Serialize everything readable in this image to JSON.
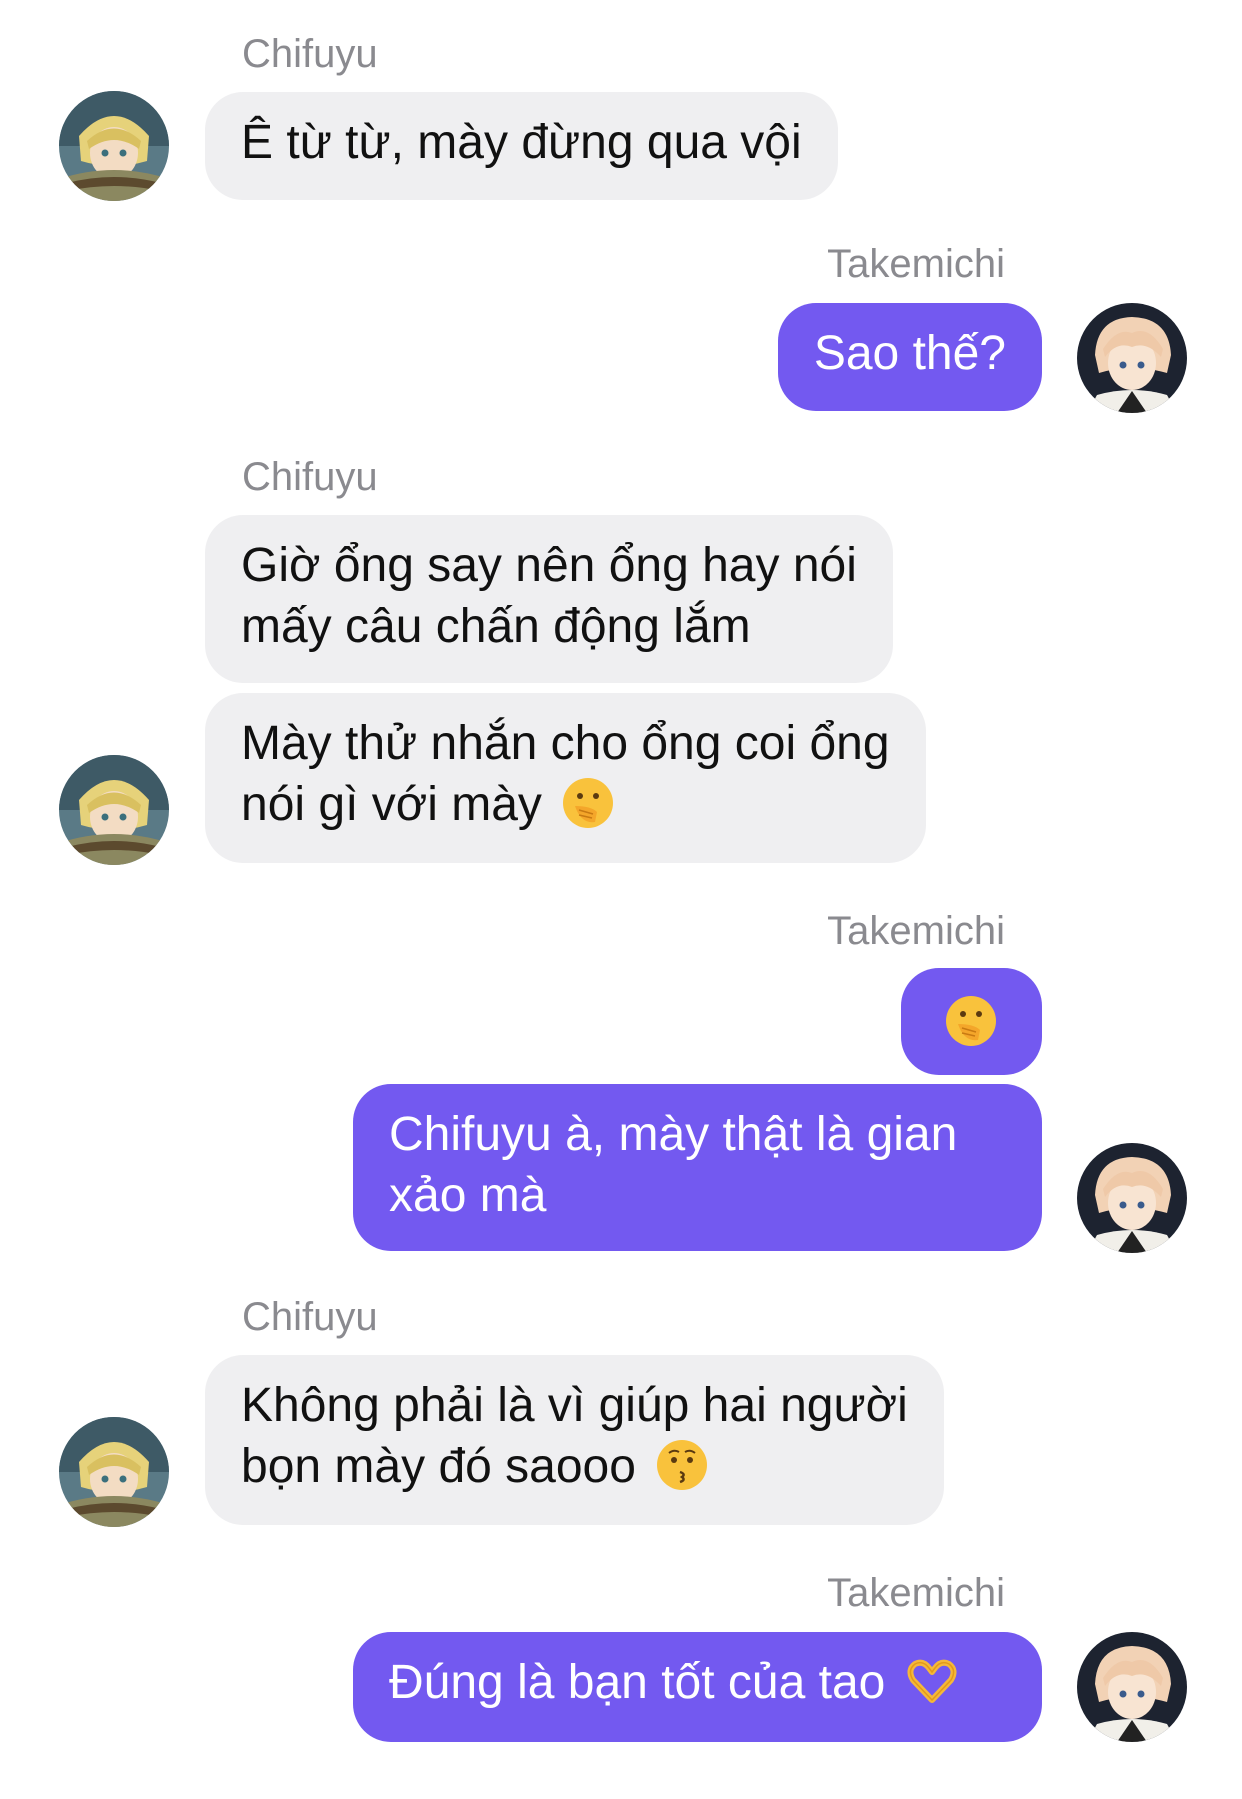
{
  "participants": {
    "friend": "Chifuyu",
    "me": "Takemichi"
  },
  "messages": [
    {
      "sender": "Chifuyu",
      "lines": [
        "Ê từ từ, mày đừng qua vội"
      ]
    },
    {
      "sender": "Takemichi",
      "lines": [
        "Sao thế?"
      ]
    },
    {
      "sender": "Chifuyu",
      "lines": [
        "Giờ ổng say nên ổng hay nói",
        "mấy câu chấn động lắm"
      ]
    },
    {
      "sender": "Chifuyu",
      "lines": [
        "Mày thử nhắn cho ổng coi ổng",
        "nói gì với mày"
      ],
      "emoji": "face-with-hand-over-mouth-emoji"
    },
    {
      "sender": "Takemichi",
      "lines": [
        ""
      ],
      "emoji": "face-with-hand-over-mouth-emoji"
    },
    {
      "sender": "Takemichi",
      "lines": [
        "Chifuyu à, mày thật là gian",
        "xảo mà"
      ]
    },
    {
      "sender": "Chifuyu",
      "lines": [
        "Không phải là vì giúp hai người",
        "bọn mày đó saooo"
      ],
      "emoji": "kissing-face-emoji"
    },
    {
      "sender": "Takemichi",
      "lines": [
        "Đúng là bạn tốt của tao"
      ],
      "emoji": "heart-hands-emoji"
    }
  ],
  "colors": {
    "outgoing_bubble": "#7359f0",
    "incoming_bubble": "#efeff1",
    "sender_name": "#8a8a8f"
  }
}
